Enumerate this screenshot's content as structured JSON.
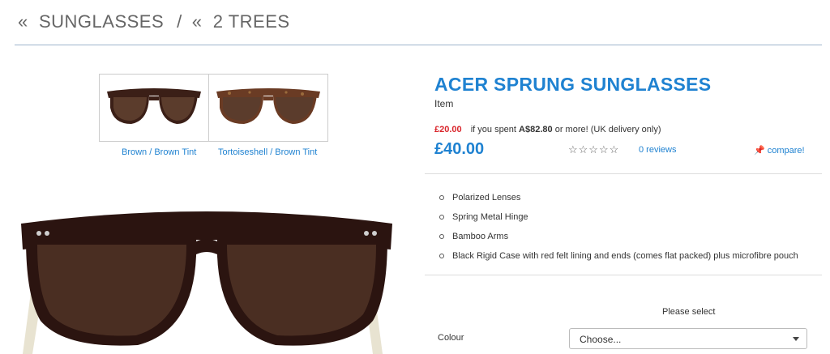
{
  "breadcrumb": {
    "items": [
      {
        "prefix": "«",
        "label": "SUNGLASSES"
      },
      {
        "separator": "/",
        "prefix": "«",
        "label": "2 TREES"
      }
    ]
  },
  "variants": [
    {
      "label": "Brown / Brown Tint",
      "frame_color": "#3b1f17",
      "lens_color": "#5b3c2c"
    },
    {
      "label": "Tortoiseshell / Brown Tint",
      "frame_color": "#6a3b24",
      "lens_color": "#5b3c2c"
    }
  ],
  "product": {
    "title": "ACER SPRUNG SUNGLASSES",
    "type": "Item",
    "offer_price": "£20.00",
    "offer_text_before": "if you spent",
    "offer_amount": "A$82.80",
    "offer_text_after": "or more! (UK delivery only)",
    "price": "£40.00",
    "rating_stars": "☆☆☆☆☆",
    "rating_value": 0,
    "reviews_label": "0 reviews",
    "compare_label": "compare!",
    "compare_icon": "pin-icon"
  },
  "features": [
    "Polarized Lenses",
    "Spring Metal Hinge",
    "Bamboo Arms",
    "Black Rigid Case with red felt lining and ends (comes flat packed) plus microfibre pouch"
  ],
  "options": {
    "heading": "Please select",
    "colour_label": "Colour",
    "colour_selected": "Choose..."
  },
  "colors": {
    "accent": "#1f82d1",
    "offer_red": "#d9252b",
    "rule": "#9db4cc"
  }
}
